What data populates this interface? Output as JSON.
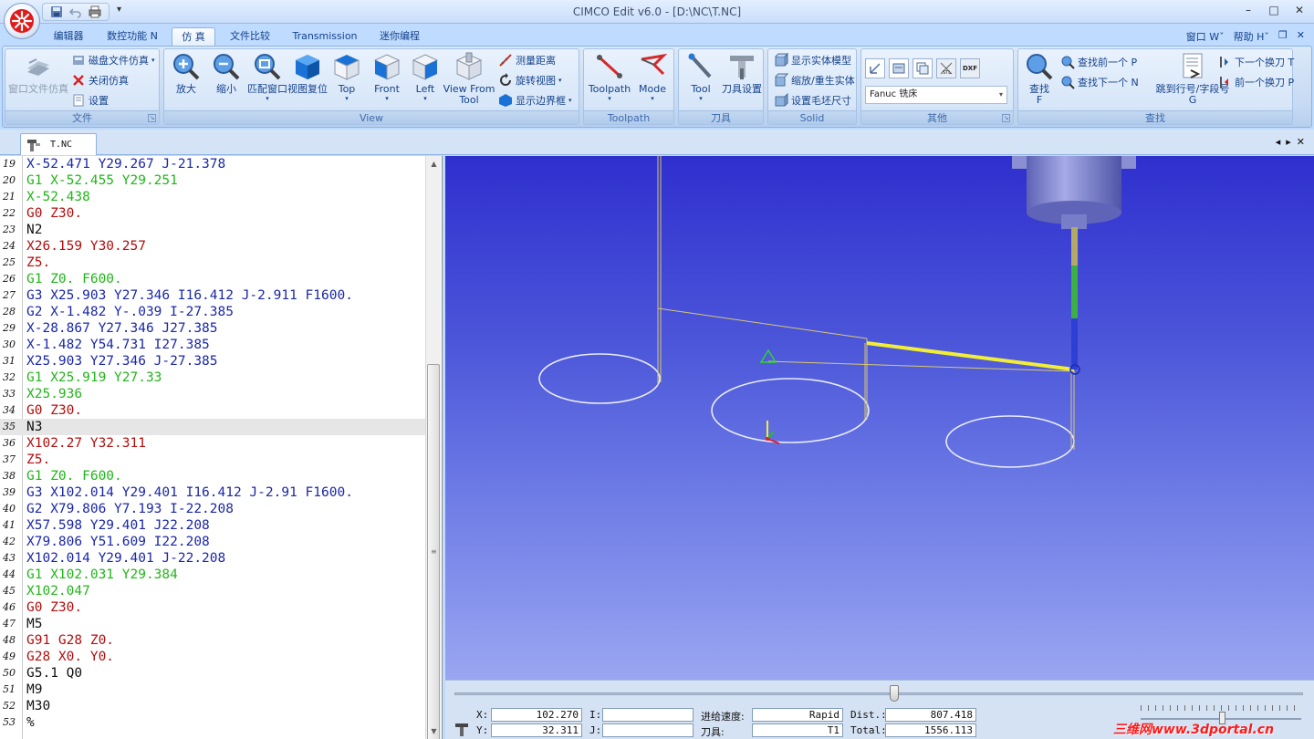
{
  "window": {
    "title": "CIMCO Edit v6.0 - [D:\\NC\\T.NC]",
    "minimize": "–",
    "maximize": "□",
    "close": "✕"
  },
  "tabs": [
    {
      "label": "编辑器"
    },
    {
      "label": "数控功能 N"
    },
    {
      "label": "仿 真"
    },
    {
      "label": "文件比较"
    },
    {
      "label": "Transmission"
    },
    {
      "label": "迷你编程"
    }
  ],
  "tabs_right": {
    "window_menu": "窗口 Wˇ",
    "help_menu": "帮助 Hˇ",
    "restore": "❐",
    "close": "✕"
  },
  "ribbon": {
    "file_group": {
      "label": "文件",
      "window_sim": "窗口文件仿真",
      "disk_sim": "磁盘文件仿真",
      "close_sim": "关闭仿真",
      "settings": "设置"
    },
    "view_group": {
      "label": "View",
      "zoom_in": "放大",
      "zoom_out": "缩小",
      "fit_window": "匹配窗口",
      "view_reset": "视图复位",
      "top": "Top",
      "front": "Front",
      "left": "Left",
      "view_from_tool_1": "View From",
      "view_from_tool_2": "Tool",
      "measure": "测量距离",
      "rotate_view": "旋转视图",
      "show_bounds": "显示边界框"
    },
    "toolpath_group": {
      "label": "Toolpath",
      "toolpath": "Toolpath",
      "mode": "Mode"
    },
    "tool_group": {
      "label": "刀具",
      "tool": "Tool",
      "tool_settings": "刀具设置"
    },
    "solid_group": {
      "label": "Solid",
      "show_solid": "显示实体模型",
      "zoom_regen": "缩放/重生实体",
      "stock_size": "设置毛坯尺寸"
    },
    "other_group": {
      "label": "其他",
      "machine_select": "Fanuc 铣床",
      "dxf": "DXF",
      "stl": "STL"
    },
    "find_group": {
      "label": "查找",
      "find_1": "查找",
      "find_2": "F",
      "find_prev": "查找前一个 P",
      "find_next": "查找下一个 N",
      "goto_1": "跳到行号/字段号",
      "goto_2": "G",
      "next_tool": "下一个换刀 T",
      "prev_tool": "前一个换刀 P"
    }
  },
  "document": {
    "tab_label": "T.NC",
    "nav_prev": "◂",
    "nav_next": "▸",
    "nav_close": "✕"
  },
  "code_lines": [
    {
      "n": "19",
      "text": "X-52.471 Y29.267 J-21.378",
      "color": "blue"
    },
    {
      "n": "20",
      "text": "G1 X-52.455 Y29.251",
      "color": "green"
    },
    {
      "n": "21",
      "text": "X-52.438",
      "color": "green"
    },
    {
      "n": "22",
      "text": "G0 Z30.",
      "color": "red"
    },
    {
      "n": "23",
      "text": "N2",
      "color": "black"
    },
    {
      "n": "24",
      "text": "X26.159 Y30.257",
      "color": "red"
    },
    {
      "n": "25",
      "text": "Z5.",
      "color": "red"
    },
    {
      "n": "26",
      "text": "G1 Z0. F600.",
      "color": "green"
    },
    {
      "n": "27",
      "text": "G3 X25.903 Y27.346 I16.412 J-2.911 F1600.",
      "color": "blue"
    },
    {
      "n": "28",
      "text": "G2 X-1.482 Y-.039 I-27.385",
      "color": "blue"
    },
    {
      "n": "29",
      "text": "X-28.867 Y27.346 J27.385",
      "color": "blue"
    },
    {
      "n": "30",
      "text": "X-1.482 Y54.731 I27.385",
      "color": "blue"
    },
    {
      "n": "31",
      "text": "X25.903 Y27.346 J-27.385",
      "color": "blue"
    },
    {
      "n": "32",
      "text": "G1 X25.919 Y27.33",
      "color": "green"
    },
    {
      "n": "33",
      "text": "X25.936",
      "color": "green"
    },
    {
      "n": "34",
      "text": "G0 Z30.",
      "color": "red"
    },
    {
      "n": "35",
      "text": "N3",
      "color": "black",
      "current": true
    },
    {
      "n": "36",
      "text": "X102.27 Y32.311",
      "color": "red"
    },
    {
      "n": "37",
      "text": "Z5.",
      "color": "red"
    },
    {
      "n": "38",
      "text": "G1 Z0. F600.",
      "color": "green"
    },
    {
      "n": "39",
      "text": "G3 X102.014 Y29.401 I16.412 J-2.91 F1600.",
      "color": "blue"
    },
    {
      "n": "40",
      "text": "G2 X79.806 Y7.193 I-22.208",
      "color": "blue"
    },
    {
      "n": "41",
      "text": "X57.598 Y29.401 J22.208",
      "color": "blue"
    },
    {
      "n": "42",
      "text": "X79.806 Y51.609 I22.208",
      "color": "blue"
    },
    {
      "n": "43",
      "text": "X102.014 Y29.401 J-22.208",
      "color": "blue"
    },
    {
      "n": "44",
      "text": "G1 X102.031 Y29.384",
      "color": "green"
    },
    {
      "n": "45",
      "text": "X102.047",
      "color": "green"
    },
    {
      "n": "46",
      "text": "G0 Z30.",
      "color": "red"
    },
    {
      "n": "47",
      "text": "M5",
      "color": "black"
    },
    {
      "n": "48",
      "text": "G91 G28 Z0.",
      "color": "red"
    },
    {
      "n": "49",
      "text": "G28 X0. Y0.",
      "color": "red"
    },
    {
      "n": "50",
      "text": "G5.1 Q0",
      "color": "black"
    },
    {
      "n": "51",
      "text": "M9",
      "color": "black"
    },
    {
      "n": "52",
      "text": "M30",
      "color": "black"
    },
    {
      "n": "53",
      "text": "%",
      "color": "black"
    }
  ],
  "status": {
    "x_label": "X:",
    "x_value": "102.270",
    "y_label": "Y:",
    "y_value": "32.311",
    "i_label": "I:",
    "i_value": "",
    "j_label": "J:",
    "j_value": "",
    "feed_label": "进给速度:",
    "feed_value": "Rapid",
    "tool_label": "刀具:",
    "tool_value": "T1",
    "dist_label": "Dist.:",
    "dist_value": "807.418",
    "total_label": "Total:",
    "total_value": "1556.113"
  },
  "watermark": "三维网www.3dportal.cn",
  "colors": {
    "code_blue": "#1a27a8",
    "code_red": "#b30e0e",
    "code_green": "#23b51b",
    "toolpath_yellow": "#f2ee35",
    "viewport_top": "#2f2fce",
    "viewport_bottom": "#9aa6f1"
  }
}
